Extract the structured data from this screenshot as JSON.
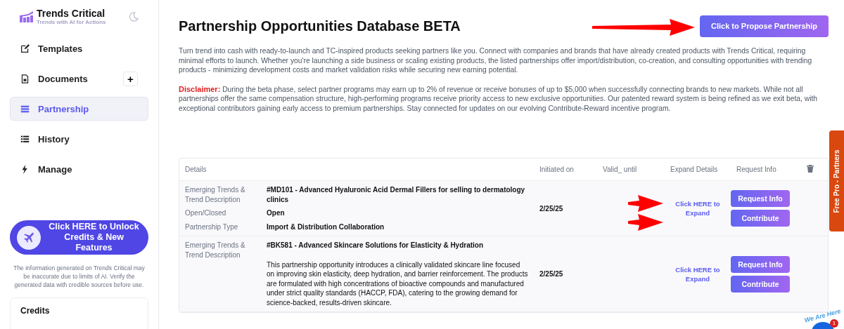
{
  "sidebar": {
    "brand": {
      "title": "Trends Critical",
      "tagline": "Trends with AI for Actions"
    },
    "items": [
      {
        "label": "Templates",
        "selected": false
      },
      {
        "label": "Documents",
        "selected": false,
        "add_button": "+"
      },
      {
        "label": "Partnership",
        "selected": true
      },
      {
        "label": "History",
        "selected": false
      },
      {
        "label": "Manage",
        "selected": false
      }
    ],
    "promo_button": "Click HERE to Unlock Credits & New Features",
    "notice": "The information generated on Trends Critical may be inaccurate due to limits of AI. Verify the generated data with credible sources before use.",
    "credits": {
      "title": "Credits"
    }
  },
  "page": {
    "title": "Partnership Opportunities Database BETA",
    "propose_button": "Click to Propose Partnership",
    "intro": "Turn trend into cash with ready-to-launch and TC-inspired products seeking partners like you. Connect with companies and brands that have already created products with Trends Critical, requiring minimal efforts to launch. Whether you're launching a side business or scaling existing products, the listed partnerships offer import/distribution, co-creation, and consulting opportunities with trending products - minimizing development costs and market validation risks while securing new earning potential.",
    "disclaimer_label": "Disclaimer:",
    "disclaimer": "During the beta phase, select partner programs may earn up to 2% of revenue or receive bonuses of up to $5,000 when successfully connecting brands to new markets. While not all partnerships offer the same compensation structure, high-performing programs receive priority access to new exclusive opportunities. Our patented reward system is being refined as we exit beta, with exceptional contributors gaining early access to premium partnerships. Stay connected for updates on our evolving Contribute-Reward incentive program."
  },
  "table": {
    "columns": [
      "Details",
      "Initiated on",
      "Valid_ until",
      "Expand Details",
      "Request Info"
    ],
    "rows": [
      {
        "details": [
          {
            "label": "Emerging Trends & Trend Description",
            "value": "#MD101 - Advanced Hyaluronic Acid Dermal Fillers for selling to dermatology clinics"
          },
          {
            "label": "Open/Closed",
            "value": "Open"
          },
          {
            "label": "Partnership Type",
            "value": "Import & Distribution Collaboration"
          }
        ],
        "initiated_on": "2/25/25",
        "expand": "Click HERE to Expand",
        "request_button": "Request Info",
        "contribute_button": "Contribute"
      },
      {
        "details": [
          {
            "label": "Emerging Trends & Trend Description",
            "value": "#BK581 - Advanced Skincare Solutions for Elasticity & Hydration",
            "description": "This partnership opportunity introduces a clinically validated skincare line focused on improving skin elasticity, deep hydration, and barrier reinforcement. The products are formulated with high concentrations of bioactive compounds and manufactured under strict quality standards (HACCP, FDA), catering to the growing demand for science-backed, results-driven skincare."
          }
        ],
        "initiated_on": "2/25/25",
        "expand": "Click HERE to Expand",
        "request_button": "Request Info",
        "contribute_button": "Contribute"
      }
    ]
  },
  "side_tab": "Free Pro - Partners",
  "chat_widget": {
    "label": "We Are Here",
    "badge": "1"
  }
}
